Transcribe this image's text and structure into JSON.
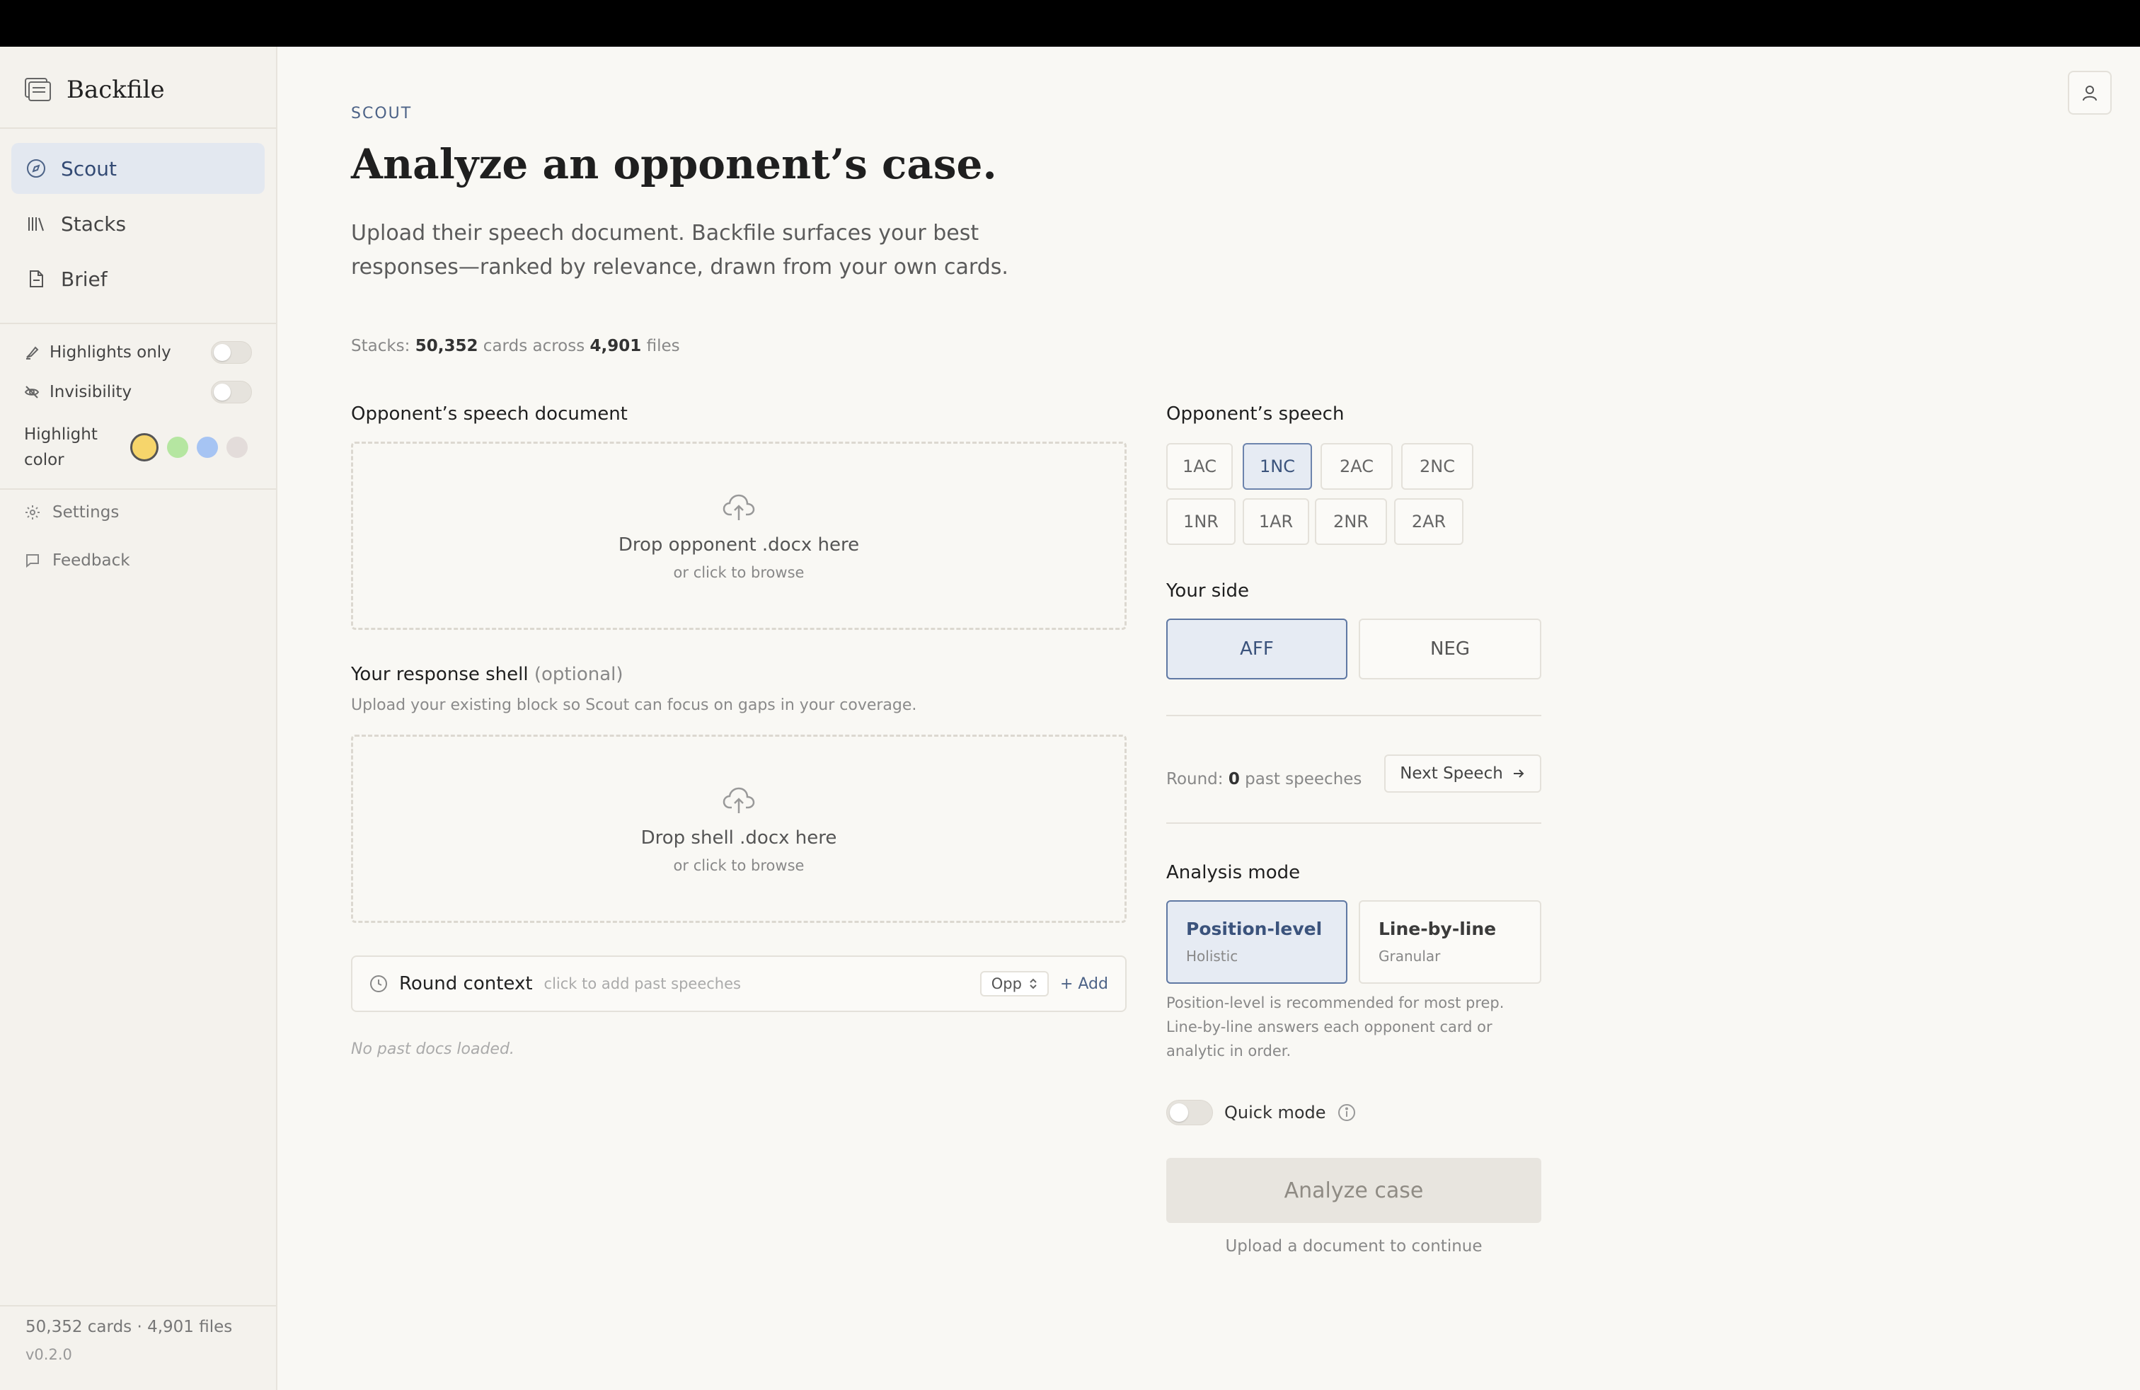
{
  "sidebar": {
    "brand": "Backfile",
    "nav": [
      {
        "label": "Scout",
        "icon": "compass-icon",
        "active": true
      },
      {
        "label": "Stacks",
        "icon": "library-icon",
        "active": false
      },
      {
        "label": "Brief",
        "icon": "document-icon",
        "active": false
      }
    ],
    "toggles": [
      {
        "label": "Highlights only",
        "icon": "highlighter-icon",
        "on": false
      },
      {
        "label": "Invisibility",
        "icon": "eye-off-icon",
        "on": false
      }
    ],
    "highlight_color": {
      "label": "Highlight color",
      "options": [
        "#f6d56b",
        "#b5e6a1",
        "#a6c4f3",
        "#e3dcda"
      ],
      "selected": "#f6d56b"
    },
    "settings_label": "Settings",
    "feedback_label": "Feedback",
    "footer_stats": "50,352 cards · 4,901 files",
    "version": "v0.2.0"
  },
  "header": {
    "kicker": "SCOUT",
    "title": "Analyze an opponent’s case.",
    "subtitle": "Upload their speech document. Backfile surfaces your best responses—ranked by relevance, drawn from your own cards.",
    "stats": {
      "prefix": "Stacks: ",
      "cards": "50,352",
      "mid": " cards across ",
      "files": "4,901",
      "suffix": " files"
    }
  },
  "opponent_doc": {
    "label": "Opponent’s speech document",
    "drop_main": "Drop opponent .docx here",
    "drop_sub": "or click to browse"
  },
  "shell": {
    "label": "Your response shell",
    "optional": "(optional)",
    "hint": "Upload your existing block so Scout can focus on gaps in your coverage.",
    "drop_main": "Drop shell .docx here",
    "drop_sub": "or click to browse"
  },
  "round_context": {
    "title": "Round context",
    "hint": "click to add past speeches",
    "select_value": "Opp",
    "add_label": "+ Add",
    "empty": "No past docs loaded."
  },
  "speech": {
    "label": "Opponent’s speech",
    "options": [
      "1AC",
      "1NC",
      "2AC",
      "2NC",
      "1NR",
      "1AR",
      "2NR",
      "2AR"
    ],
    "selected": "1NC"
  },
  "side": {
    "label": "Your side",
    "options": [
      "AFF",
      "NEG"
    ],
    "selected": "AFF"
  },
  "round": {
    "prefix": "Round: ",
    "count": "0",
    "suffix": " past speeches",
    "next_label": "Next Speech"
  },
  "analysis": {
    "label": "Analysis mode",
    "modes": [
      {
        "title": "Position-level",
        "sub": "Holistic",
        "selected": true
      },
      {
        "title": "Line-by-line",
        "sub": "Granular",
        "selected": false
      }
    ],
    "description": "Position-level is recommended for most prep. Line-by-line answers each opponent card or analytic in order."
  },
  "quick_mode": {
    "label": "Quick mode",
    "on": false
  },
  "analyze": {
    "button": "Analyze case",
    "hint": "Upload a document to continue"
  }
}
